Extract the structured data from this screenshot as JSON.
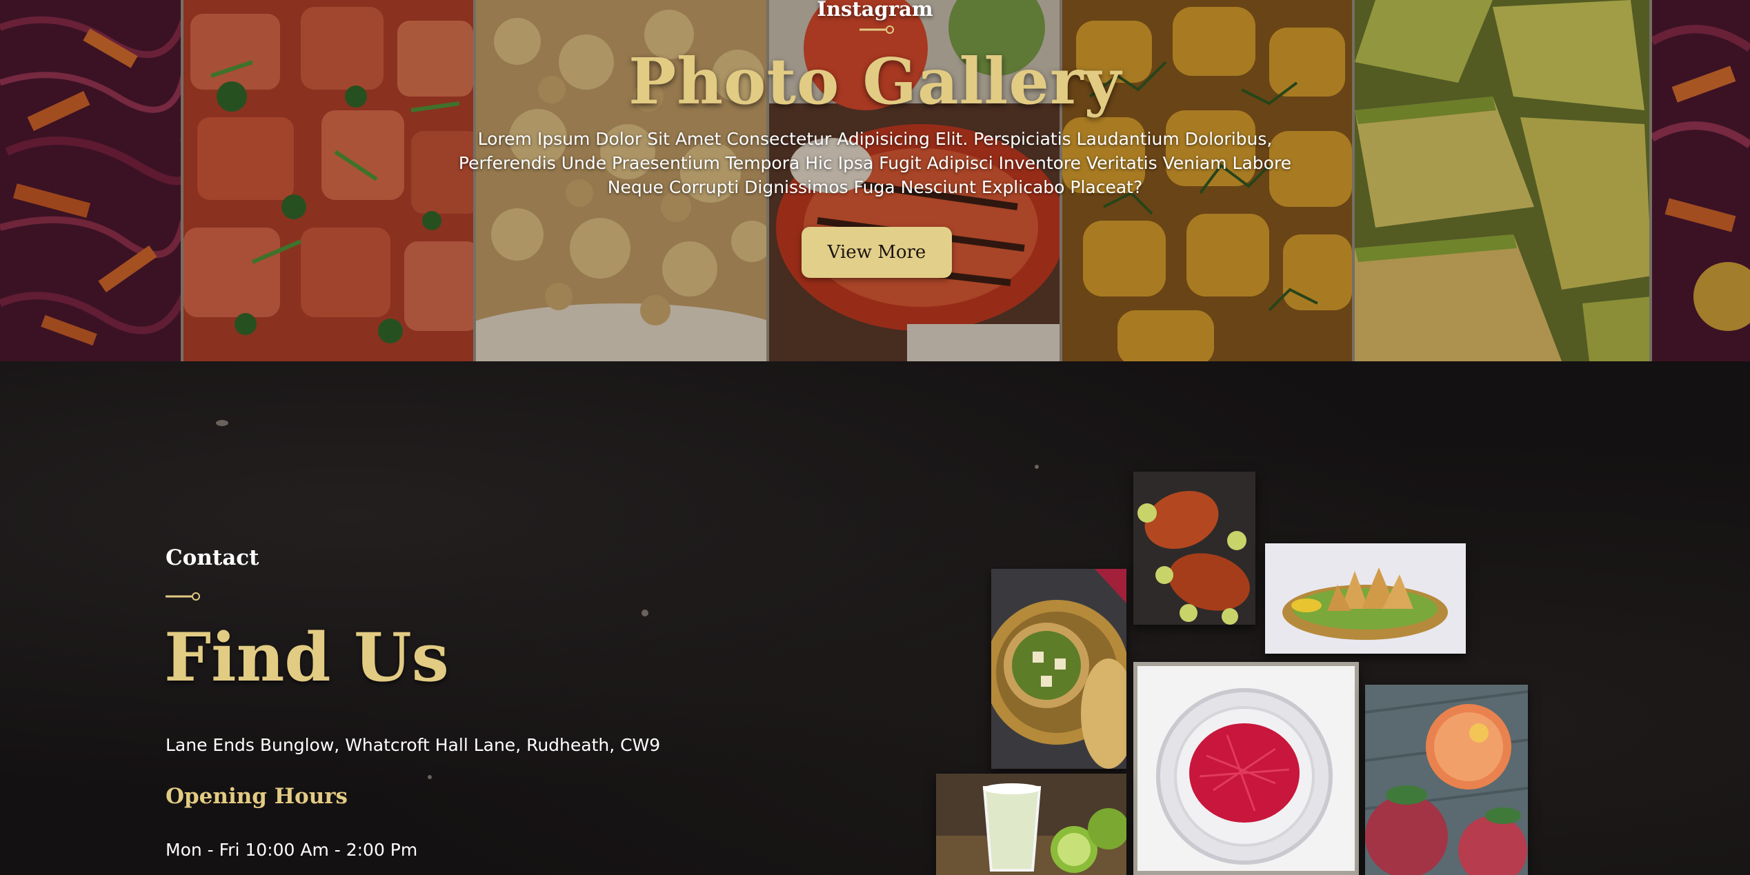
{
  "gallery": {
    "eyebrow": "Instagram",
    "title": "Photo Gallery",
    "description": "Lorem Ipsum Dolor Sit Amet Consectetur Adipisicing Elit. Perspiciatis Laudantium Doloribus, Perferendis Unde Praesentium Tempora Hic Ipsa Fugit Adipisci Inventore Veritatis Veniam Labore Neque Corrupti Dignissimos Fuga Nesciunt Explicabo Placeat?",
    "button_label": "View More",
    "panels": [
      "red-cabbage-salad",
      "tomato-salad",
      "fried-rice",
      "grilled-tomato",
      "herb-potatoes",
      "avocado-slices",
      "mixed-salad"
    ]
  },
  "contact": {
    "eyebrow": "Contact",
    "title": "Find Us",
    "address": "Lane Ends Bunglow, Whatcroft Hall Lane, Rudheath, CW9",
    "hours_title": "Opening Hours",
    "hours": "Mon - Fri 10:00 Am - 2:00 Pm",
    "collage": [
      "tandoori-chicken",
      "samosa",
      "palak-paneer",
      "saffron",
      "cocktails",
      "margarita"
    ]
  },
  "colors": {
    "accent_gold": "#e2cb83",
    "button_gold": "#e2cf8a",
    "background_dark": "#141112",
    "text_white": "#ffffff"
  }
}
